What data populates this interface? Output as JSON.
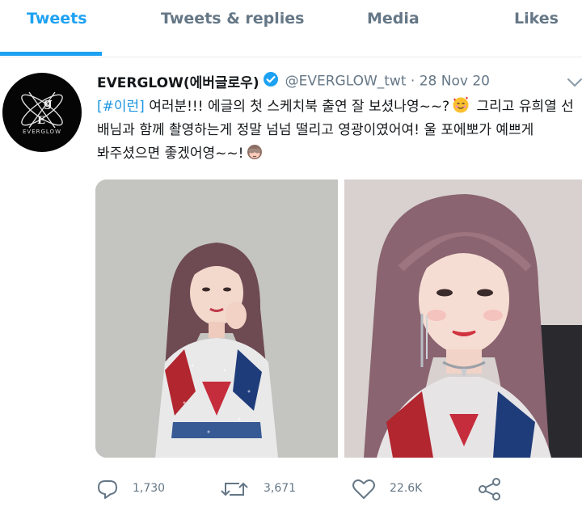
{
  "tabs": [
    {
      "label": "Tweets",
      "active": true
    },
    {
      "label": "Tweets & replies",
      "active": false
    },
    {
      "label": "Media",
      "active": false
    },
    {
      "label": "Likes",
      "active": false
    }
  ],
  "tweet": {
    "avatar_text": "EVERGLOW",
    "display_name": "EVERGLOW(에버글로우)",
    "verified_icon": "verified-badge-icon",
    "handle": "@EVERGLOW_twt",
    "separator": "·",
    "date": "28 Nov 20",
    "text": {
      "hashtag": "[#이런]",
      "line1_rest": " 여러분!!! 에글의 첫 스케치북 출연 잘 보셨나영~~?",
      "line1_after_emoji": " 그리고 유희열 선",
      "line2": "배님과 함께 촬영하는게 정말 넘넘 떨리고 영광이였어여! 울 포에뽀가 예쁘게",
      "line3": "봐주셨으면 좋겠어영~~!"
    },
    "emoji_1": "smiling-face-with-hearts-emoji",
    "emoji_2": "see-no-evil-monkey-emoji"
  },
  "actions": {
    "reply_count": "1,730",
    "retweet_count": "3,671",
    "like_count": "22.6K",
    "share_icon": "share-icon"
  },
  "colors": {
    "accent": "#1da1f2",
    "hashtag": "#1b95e0",
    "muted": "#657786"
  }
}
